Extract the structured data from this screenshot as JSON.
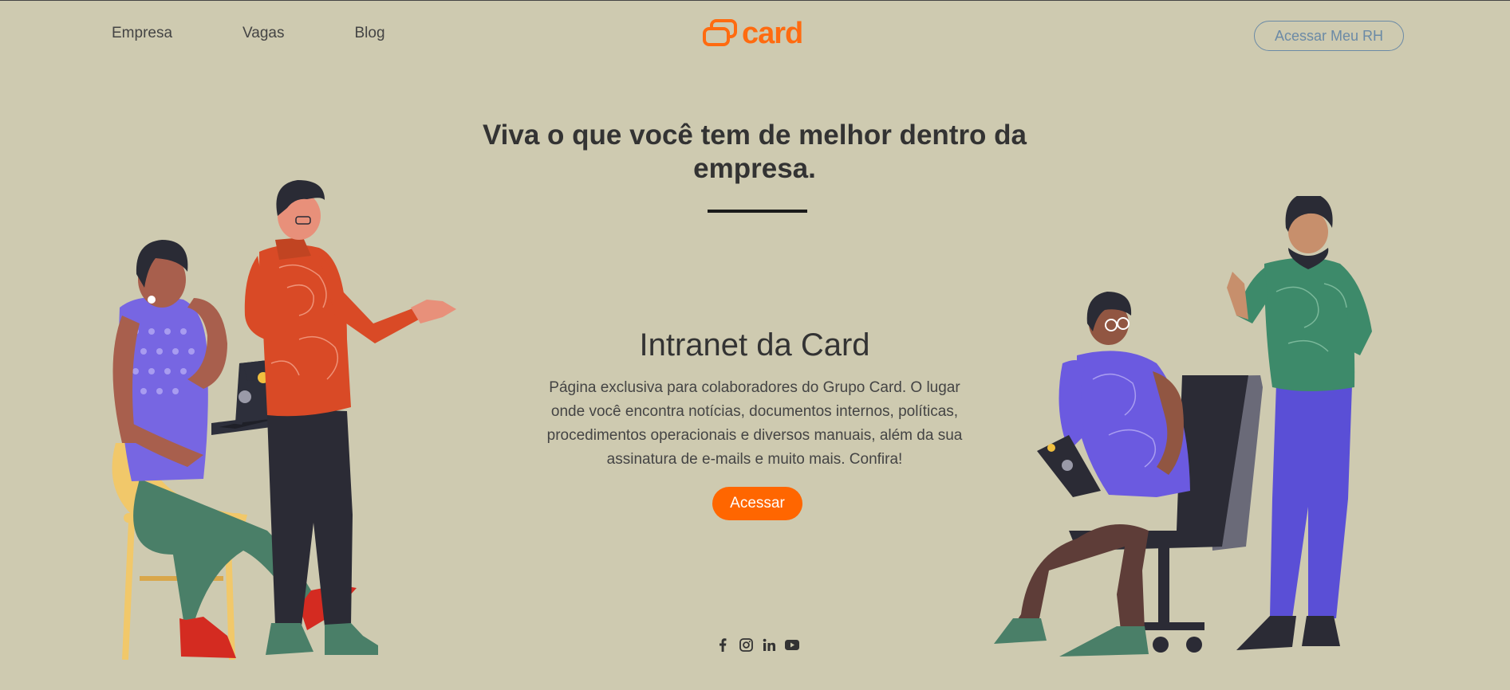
{
  "nav": {
    "items": [
      {
        "label": "Empresa"
      },
      {
        "label": "Vagas"
      },
      {
        "label": "Blog"
      }
    ]
  },
  "logo": {
    "text": "card",
    "icon": "stacked-cards-logo"
  },
  "header": {
    "rh_button_label": "Acessar Meu RH"
  },
  "hero": {
    "title": "Viva o que você tem de melhor dentro da empresa."
  },
  "intranet": {
    "title": "Intranet da Card",
    "description": "Página exclusiva para colaboradores do Grupo Card. O lugar onde você encontra notícias, documentos internos, políticas, procedimentos operacionais e diversos manuais, além da sua assinatura de e-mails e muito mais. Confira!",
    "cta_label": "Acessar"
  },
  "social": [
    "facebook-icon",
    "instagram-icon",
    "linkedin-icon",
    "youtube-icon"
  ],
  "colors": {
    "background": "#cecab0",
    "accent": "#ff6600",
    "outline": "#6b8aa6"
  }
}
